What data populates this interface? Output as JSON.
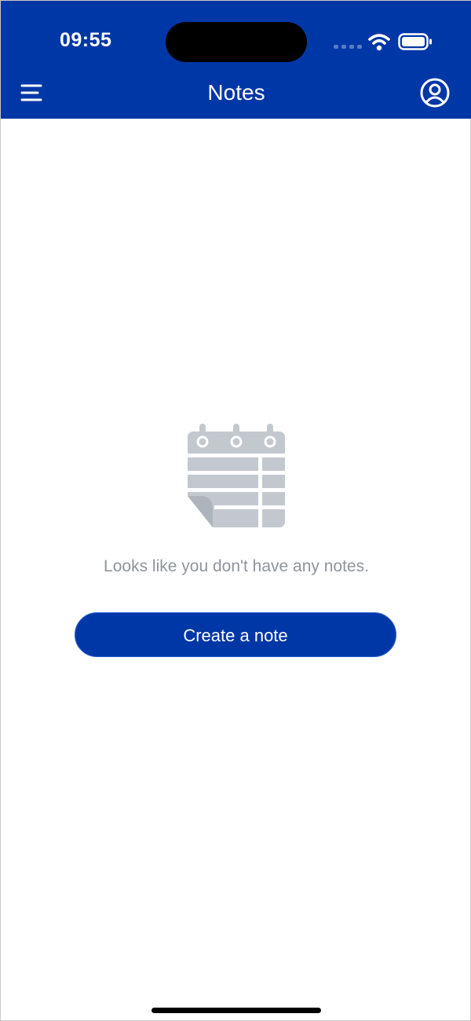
{
  "status_bar": {
    "time": "09:55"
  },
  "header": {
    "title": "Notes",
    "menu_icon": "menu-icon",
    "profile_icon": "profile-icon"
  },
  "empty_state": {
    "icon": "notes-calendar-icon",
    "message": "Looks like you don't have any notes.",
    "action_label": "Create a note"
  },
  "colors": {
    "brand": "#0037a6",
    "icon_gray": "#c3c8cf",
    "text_gray": "#8f949c"
  }
}
